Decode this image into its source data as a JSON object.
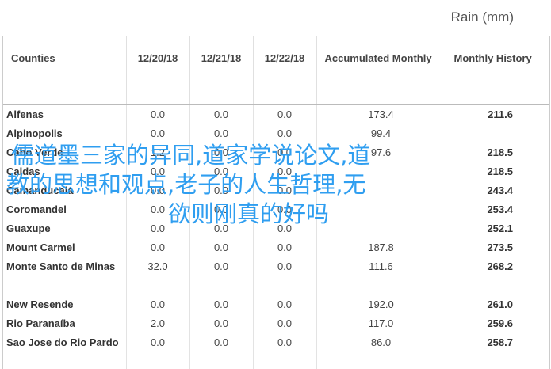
{
  "unit_label": "Rain (mm)",
  "columns": [
    "Counties",
    "12/20/18",
    "12/21/18",
    "12/22/18",
    "Accumulated Monthly",
    "Monthly History"
  ],
  "rows": [
    {
      "county": "Alfenas",
      "d1": "0.0",
      "d2": "0.0",
      "d3": "0.0",
      "acc": "173.4",
      "hist": "211.6"
    },
    {
      "county": "Alpinopolis",
      "d1": "0.0",
      "d2": "0.0",
      "d3": "0.0",
      "acc": "99.4",
      "hist": ""
    },
    {
      "county": "Cabo Verde",
      "d1": "1.2",
      "d2": "0.0",
      "d3": "0.0",
      "acc": "97.6",
      "hist": "218.5"
    },
    {
      "county": "Caldas",
      "d1": "0.0",
      "d2": "0.0",
      "d3": "0.0",
      "acc": "",
      "hist": "218.5"
    },
    {
      "county": "Camanducaia",
      "d1": "0.0",
      "d2": "0.0",
      "d3": "0.0",
      "acc": "",
      "hist": "243.4"
    },
    {
      "county": "Coromandel",
      "d1": "0.0",
      "d2": "0.0",
      "d3": "0.0",
      "acc": "",
      "hist": "253.4"
    },
    {
      "county": "Guaxupe",
      "d1": "0.0",
      "d2": "0.0",
      "d3": "0.0",
      "acc": "",
      "hist": "252.1"
    },
    {
      "county": "Mount Carmel",
      "d1": "0.0",
      "d2": "0.0",
      "d3": "0.0",
      "acc": "187.8",
      "hist": "273.5"
    },
    {
      "county": "Monte Santo de Minas",
      "d1": "32.0",
      "d2": "0.0",
      "d3": "0.0",
      "acc": "111.6",
      "hist": "268.2"
    },
    {
      "county": "New Resende",
      "d1": "0.0",
      "d2": "0.0",
      "d3": "0.0",
      "acc": "192.0",
      "hist": "261.0"
    },
    {
      "county": "Rio Paranaíba",
      "d1": "2.0",
      "d2": "0.0",
      "d3": "0.0",
      "acc": "117.0",
      "hist": "259.6"
    },
    {
      "county": "Sao Jose do Rio Pardo",
      "d1": "0.0",
      "d2": "0.0",
      "d3": "0.0",
      "acc": "86.0",
      "hist": "258.7"
    }
  ],
  "watermark": {
    "line1": "儒道墨三家的异同,道家学说论文,道",
    "line2": "教的思想和观点,老子的人生哲理,无",
    "line3": "欲则刚真的好吗"
  },
  "colors": {
    "watermark": "#2f9ef0",
    "header_rule": "#bbbbbb"
  }
}
